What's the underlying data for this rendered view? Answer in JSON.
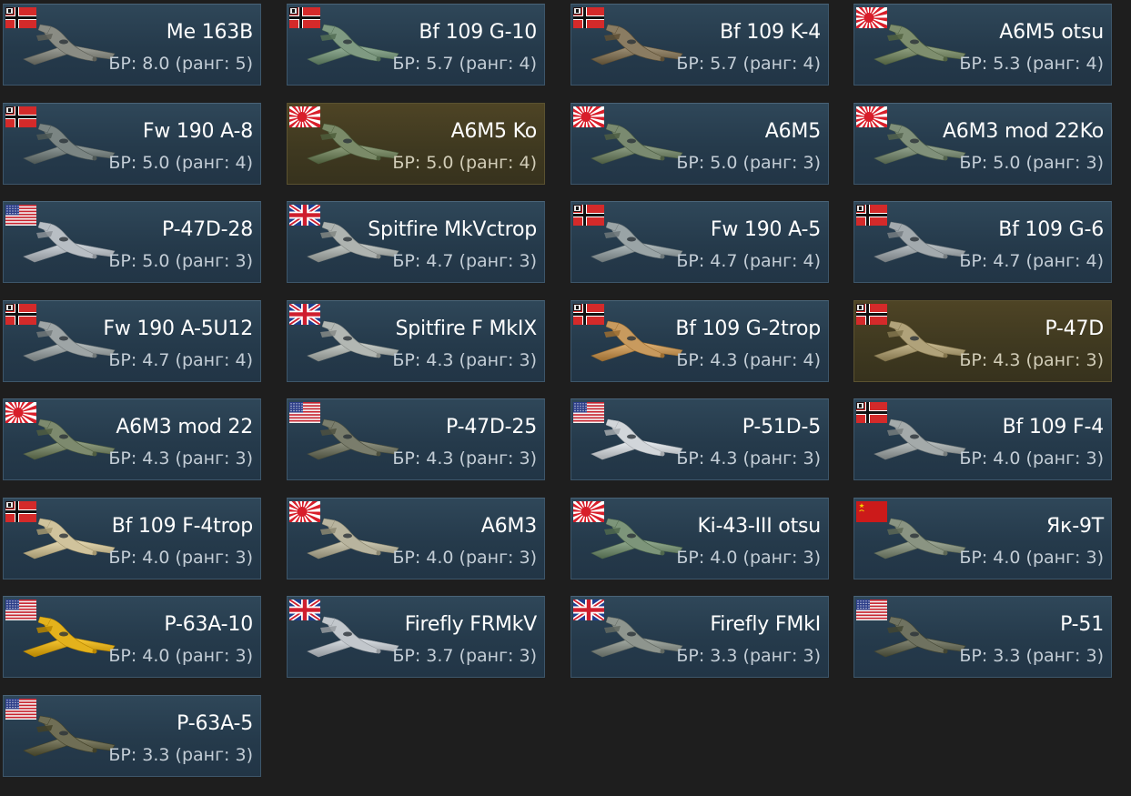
{
  "vehicles": [
    {
      "name": "Me 163B",
      "br": "БР: 8.0 (ранг: 5)",
      "flag": "germany",
      "premium": false,
      "plane_color": "#8a8c84",
      "plane_icon": "me163-icon"
    },
    {
      "name": "Bf 109 G-10",
      "br": "БР: 5.7 (ранг: 4)",
      "flag": "germany",
      "premium": false,
      "plane_color": "#7f9a82",
      "plane_icon": "bf109-icon"
    },
    {
      "name": "Bf 109 K-4",
      "br": "БР: 5.7 (ранг: 4)",
      "flag": "germany",
      "premium": false,
      "plane_color": "#8a7c62",
      "plane_icon": "bf109-icon"
    },
    {
      "name": "A6M5 otsu",
      "br": "БР: 5.3 (ранг: 4)",
      "flag": "japan",
      "premium": false,
      "plane_color": "#7e8e6e",
      "plane_icon": "zero-icon"
    },
    {
      "name": "Fw 190 A-8",
      "br": "БР: 5.0 (ранг: 4)",
      "flag": "germany",
      "premium": false,
      "plane_color": "#7b8583",
      "plane_icon": "fw190-icon"
    },
    {
      "name": "A6M5 Ko",
      "br": "БР: 5.0 (ранг: 4)",
      "flag": "japan",
      "premium": true,
      "plane_color": "#7a8a68",
      "plane_icon": "zero-icon"
    },
    {
      "name": "A6M5",
      "br": "БР: 5.0 (ранг: 3)",
      "flag": "japan",
      "premium": false,
      "plane_color": "#7a8a70",
      "plane_icon": "zero-icon"
    },
    {
      "name": "A6M3 mod 22Ko",
      "br": "БР: 5.0 (ранг: 3)",
      "flag": "japan",
      "premium": false,
      "plane_color": "#80907a",
      "plane_icon": "zero-icon"
    },
    {
      "name": "P-47D-28",
      "br": "БР: 5.0 (ранг: 3)",
      "flag": "usa",
      "premium": false,
      "plane_color": "#b8bec4",
      "plane_icon": "p47-icon"
    },
    {
      "name": "Spitfire MkVctrop",
      "br": "БР: 4.7 (ранг: 3)",
      "flag": "uk",
      "premium": false,
      "plane_color": "#aeb3b0",
      "plane_icon": "spitfire-icon"
    },
    {
      "name": "Fw 190 A-5",
      "br": "БР: 4.7 (ранг: 4)",
      "flag": "germany",
      "premium": false,
      "plane_color": "#9aa4a6",
      "plane_icon": "fw190-icon"
    },
    {
      "name": "Bf 109 G-6",
      "br": "БР: 4.7 (ранг: 4)",
      "flag": "germany",
      "premium": false,
      "plane_color": "#a3aaae",
      "plane_icon": "bf109-icon"
    },
    {
      "name": "Fw 190 A-5U12",
      "br": "БР: 4.7 (ранг: 4)",
      "flag": "germany",
      "premium": false,
      "plane_color": "#9ea5a6",
      "plane_icon": "fw190-icon"
    },
    {
      "name": "Spitfire F MkIX",
      "br": "БР: 4.3 (ранг: 3)",
      "flag": "uk",
      "premium": false,
      "plane_color": "#b2b7b3",
      "plane_icon": "spitfire-icon"
    },
    {
      "name": "Bf 109 G-2trop",
      "br": "БР: 4.3 (ранг: 4)",
      "flag": "germany",
      "premium": false,
      "plane_color": "#c89a5e",
      "plane_icon": "bf109-icon"
    },
    {
      "name": "P-47D",
      "br": "БР: 4.3 (ранг: 3)",
      "flag": "germany",
      "premium": true,
      "plane_color": "#b0a27a",
      "plane_icon": "p47-icon"
    },
    {
      "name": "A6M3 mod 22",
      "br": "БР: 4.3 (ранг: 3)",
      "flag": "japan",
      "premium": false,
      "plane_color": "#7d8a6e",
      "plane_icon": "zero-icon"
    },
    {
      "name": "P-47D-25",
      "br": "БР: 4.3 (ранг: 3)",
      "flag": "usa",
      "premium": false,
      "plane_color": "#7a7d6c",
      "plane_icon": "p47-icon"
    },
    {
      "name": "P-51D-5",
      "br": "БР: 4.3 (ранг: 3)",
      "flag": "usa",
      "premium": false,
      "plane_color": "#d2d6da",
      "plane_icon": "p51-icon"
    },
    {
      "name": "Bf 109 F-4",
      "br": "БР: 4.0 (ранг: 3)",
      "flag": "germany",
      "premium": false,
      "plane_color": "#a4aaaa",
      "plane_icon": "bf109-icon"
    },
    {
      "name": "Bf 109 F-4trop",
      "br": "БР: 4.0 (ранг: 3)",
      "flag": "germany",
      "premium": false,
      "plane_color": "#d0c39c",
      "plane_icon": "bf109-icon"
    },
    {
      "name": "A6M3",
      "br": "БР: 4.0 (ранг: 3)",
      "flag": "japan",
      "premium": false,
      "plane_color": "#b8b49e",
      "plane_icon": "zero-icon"
    },
    {
      "name": "Ki-43-III otsu",
      "br": "БР: 4.0 (ранг: 3)",
      "flag": "japan",
      "premium": false,
      "plane_color": "#7d957a",
      "plane_icon": "ki43-icon"
    },
    {
      "name": "Як-9Т",
      "br": "БР: 4.0 (ранг: 3)",
      "flag": "ussr",
      "premium": false,
      "plane_color": "#8a9482",
      "plane_icon": "yak9-icon"
    },
    {
      "name": "P-63A-10",
      "br": "БР: 4.0 (ранг: 3)",
      "flag": "usa",
      "premium": false,
      "plane_color": "#e4b21c",
      "plane_icon": "p63-icon"
    },
    {
      "name": "Firefly FRMkV",
      "br": "БР: 3.7 (ранг: 3)",
      "flag": "uk",
      "premium": false,
      "plane_color": "#c2c7cc",
      "plane_icon": "firefly-icon"
    },
    {
      "name": "Firefly FMkI",
      "br": "БР: 3.3 (ранг: 3)",
      "flag": "uk",
      "premium": false,
      "plane_color": "#8e958e",
      "plane_icon": "firefly-icon"
    },
    {
      "name": "P-51",
      "br": "БР: 3.3 (ранг: 3)",
      "flag": "usa",
      "premium": false,
      "plane_color": "#6f7260",
      "plane_icon": "p51-icon"
    },
    {
      "name": "P-63A-5",
      "br": "БР: 3.3 (ранг: 3)",
      "flag": "usa",
      "premium": false,
      "plane_color": "#6f6e55",
      "plane_icon": "p63-icon"
    }
  ]
}
